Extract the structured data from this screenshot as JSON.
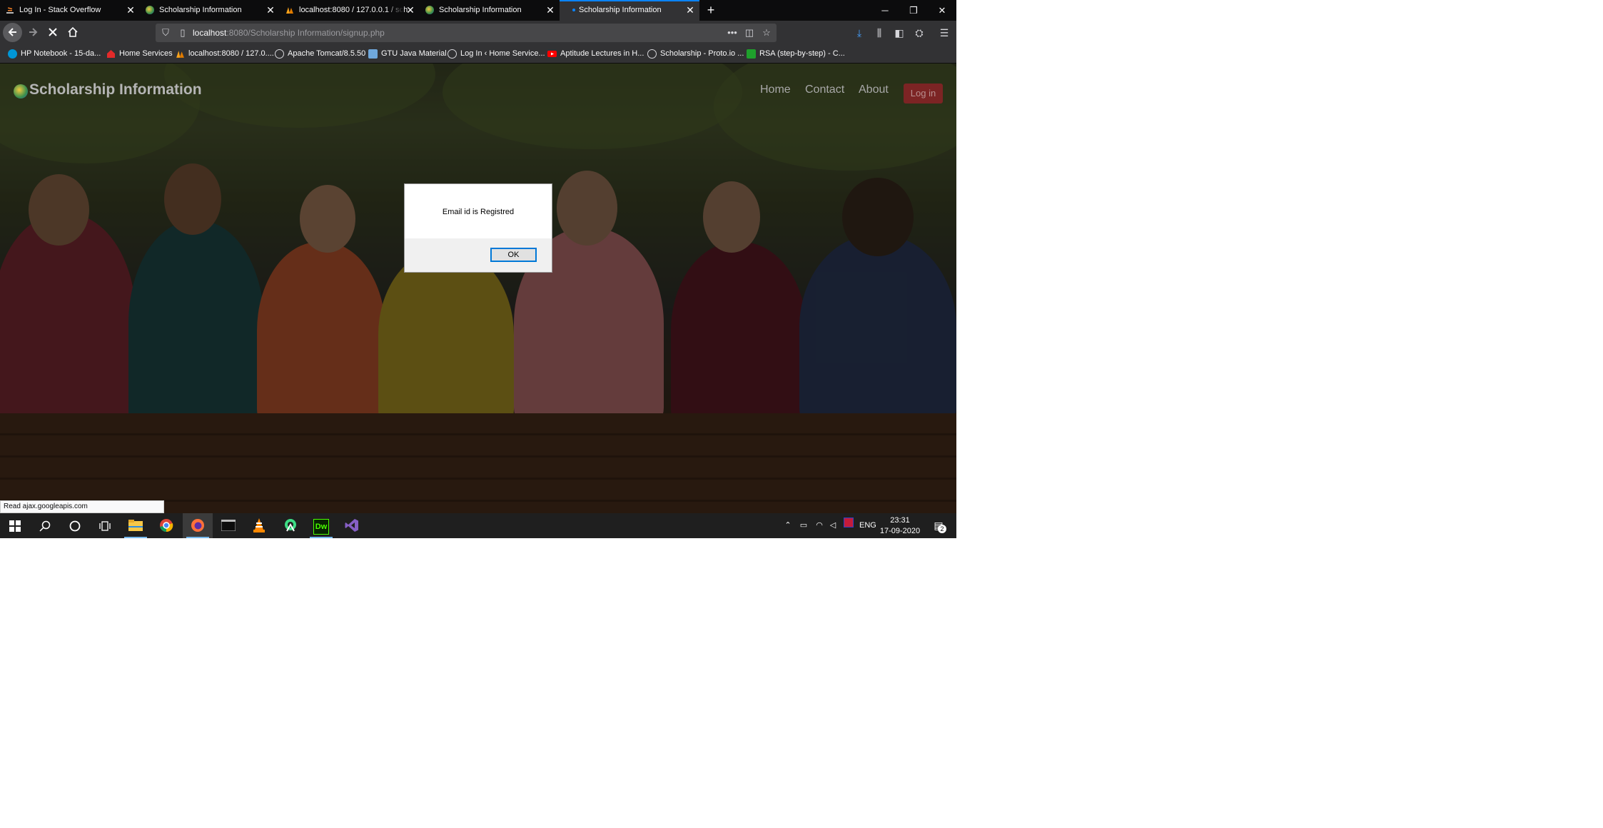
{
  "browser": {
    "tabs": [
      {
        "title": "Log In - Stack Overflow",
        "icon": "stackoverflow-icon",
        "active": false
      },
      {
        "title": "Scholarship Information",
        "icon": "globe-logo-icon",
        "active": false
      },
      {
        "title": "localhost:8080 / 127.0.0.1 / sch",
        "icon": "phpmyadmin-icon",
        "active": false
      },
      {
        "title": "Scholarship Information",
        "icon": "globe-logo-icon",
        "active": false
      },
      {
        "title": "Scholarship Information",
        "icon": "loading-dot-icon",
        "active": true
      }
    ],
    "new_tab": "+",
    "window_controls": {
      "minimize": "─",
      "restore": "❐",
      "close": "✕"
    },
    "url_host": "localhost",
    "url_rest": ":8080/Scholarship Information/signup.php",
    "bookmarks": [
      "HP Notebook - 15-da...",
      "Home Services",
      "localhost:8080 / 127.0....",
      "Apache Tomcat/8.5.50",
      "GTU Java Material",
      "Log In ‹ Home Service...",
      "Aptitude Lectures in H...",
      "Scholarship - Proto.io ...",
      "RSA (step-by-step) - C..."
    ],
    "status_text": "Read ajax.googleapis.com"
  },
  "site": {
    "title": "Scholarship Information",
    "nav": [
      "Home",
      "Contact",
      "About"
    ],
    "login_label": "Log in"
  },
  "dialog": {
    "message": "Email id is Registred",
    "ok_label": "OK"
  },
  "taskbar": {
    "apps": [
      "start",
      "search",
      "cortana",
      "task-view",
      "file-explorer",
      "chrome",
      "firefox",
      "terminal",
      "vlc",
      "android-studio",
      "dreamweaver",
      "visual-studio"
    ],
    "dreamweaver_label": "Dw",
    "language": "ENG",
    "time": "23:31",
    "date": "17-09-2020",
    "notification_count": "2"
  },
  "colors": {
    "accent": "#0a84ff",
    "login_button": "#7c2424",
    "taskbar": "#1f1f1f"
  }
}
